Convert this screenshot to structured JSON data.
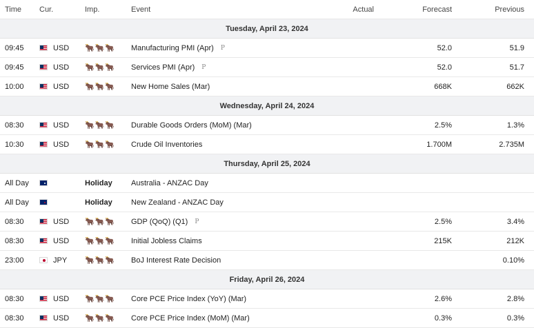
{
  "header": {
    "time": "Time",
    "currency": "Cur.",
    "importance": "Imp.",
    "event": "Event",
    "actual": "Actual",
    "forecast": "Forecast",
    "previous": "Previous"
  },
  "importance_icon": "bull-icon",
  "preliminary_mark": "P",
  "groups": [
    {
      "date": "Tuesday, April 23, 2024",
      "rows": [
        {
          "time": "09:45",
          "flag": "us",
          "currency": "USD",
          "imp": "🐂🐂🐂",
          "event": "Manufacturing PMI (Apr)",
          "prelim": true,
          "actual": "",
          "forecast": "52.0",
          "previous": "51.9"
        },
        {
          "time": "09:45",
          "flag": "us",
          "currency": "USD",
          "imp": "🐂🐂🐂",
          "event": "Services PMI (Apr)",
          "prelim": true,
          "actual": "",
          "forecast": "52.0",
          "previous": "51.7"
        },
        {
          "time": "10:00",
          "flag": "us",
          "currency": "USD",
          "imp": "🐂🐂🐂",
          "event": "New Home Sales (Mar)",
          "prelim": false,
          "actual": "",
          "forecast": "668K",
          "previous": "662K"
        }
      ]
    },
    {
      "date": "Wednesday, April 24, 2024",
      "rows": [
        {
          "time": "08:30",
          "flag": "us",
          "currency": "USD",
          "imp": "🐂🐂🐂",
          "event": "Durable Goods Orders (MoM) (Mar)",
          "prelim": false,
          "actual": "",
          "forecast": "2.5%",
          "previous": "1.3%"
        },
        {
          "time": "10:30",
          "flag": "us",
          "currency": "USD",
          "imp": "🐂🐂🐂",
          "event": "Crude Oil Inventories",
          "prelim": false,
          "actual": "",
          "forecast": "1.700M",
          "previous": "2.735M"
        }
      ]
    },
    {
      "date": "Thursday, April 25, 2024",
      "rows": [
        {
          "time": "All Day",
          "flag": "au",
          "currency": "",
          "imp": "Holiday",
          "holiday": true,
          "event": "Australia - ANZAC Day",
          "prelim": false,
          "actual": "",
          "forecast": "",
          "previous": ""
        },
        {
          "time": "All Day",
          "flag": "nz",
          "currency": "",
          "imp": "Holiday",
          "holiday": true,
          "event": "New Zealand - ANZAC Day",
          "prelim": false,
          "actual": "",
          "forecast": "",
          "previous": ""
        },
        {
          "time": "08:30",
          "flag": "us",
          "currency": "USD",
          "imp": "🐂🐂🐂",
          "event": "GDP (QoQ) (Q1)",
          "prelim": true,
          "actual": "",
          "forecast": "2.5%",
          "previous": "3.4%"
        },
        {
          "time": "08:30",
          "flag": "us",
          "currency": "USD",
          "imp": "🐂🐂🐂",
          "event": "Initial Jobless Claims",
          "prelim": false,
          "actual": "",
          "forecast": "215K",
          "previous": "212K"
        },
        {
          "time": "23:00",
          "flag": "jp",
          "currency": "JPY",
          "imp": "🐂🐂🐂",
          "event": "BoJ Interest Rate Decision",
          "prelim": false,
          "actual": "",
          "forecast": "",
          "previous": "0.10%"
        }
      ]
    },
    {
      "date": "Friday, April 26, 2024",
      "rows": [
        {
          "time": "08:30",
          "flag": "us",
          "currency": "USD",
          "imp": "🐂🐂🐂",
          "event": "Core PCE Price Index (YoY) (Mar)",
          "prelim": false,
          "actual": "",
          "forecast": "2.6%",
          "previous": "2.8%"
        },
        {
          "time": "08:30",
          "flag": "us",
          "currency": "USD",
          "imp": "🐂🐂🐂",
          "event": "Core PCE Price Index (MoM) (Mar)",
          "prelim": false,
          "actual": "",
          "forecast": "0.3%",
          "previous": "0.3%"
        }
      ]
    }
  ]
}
